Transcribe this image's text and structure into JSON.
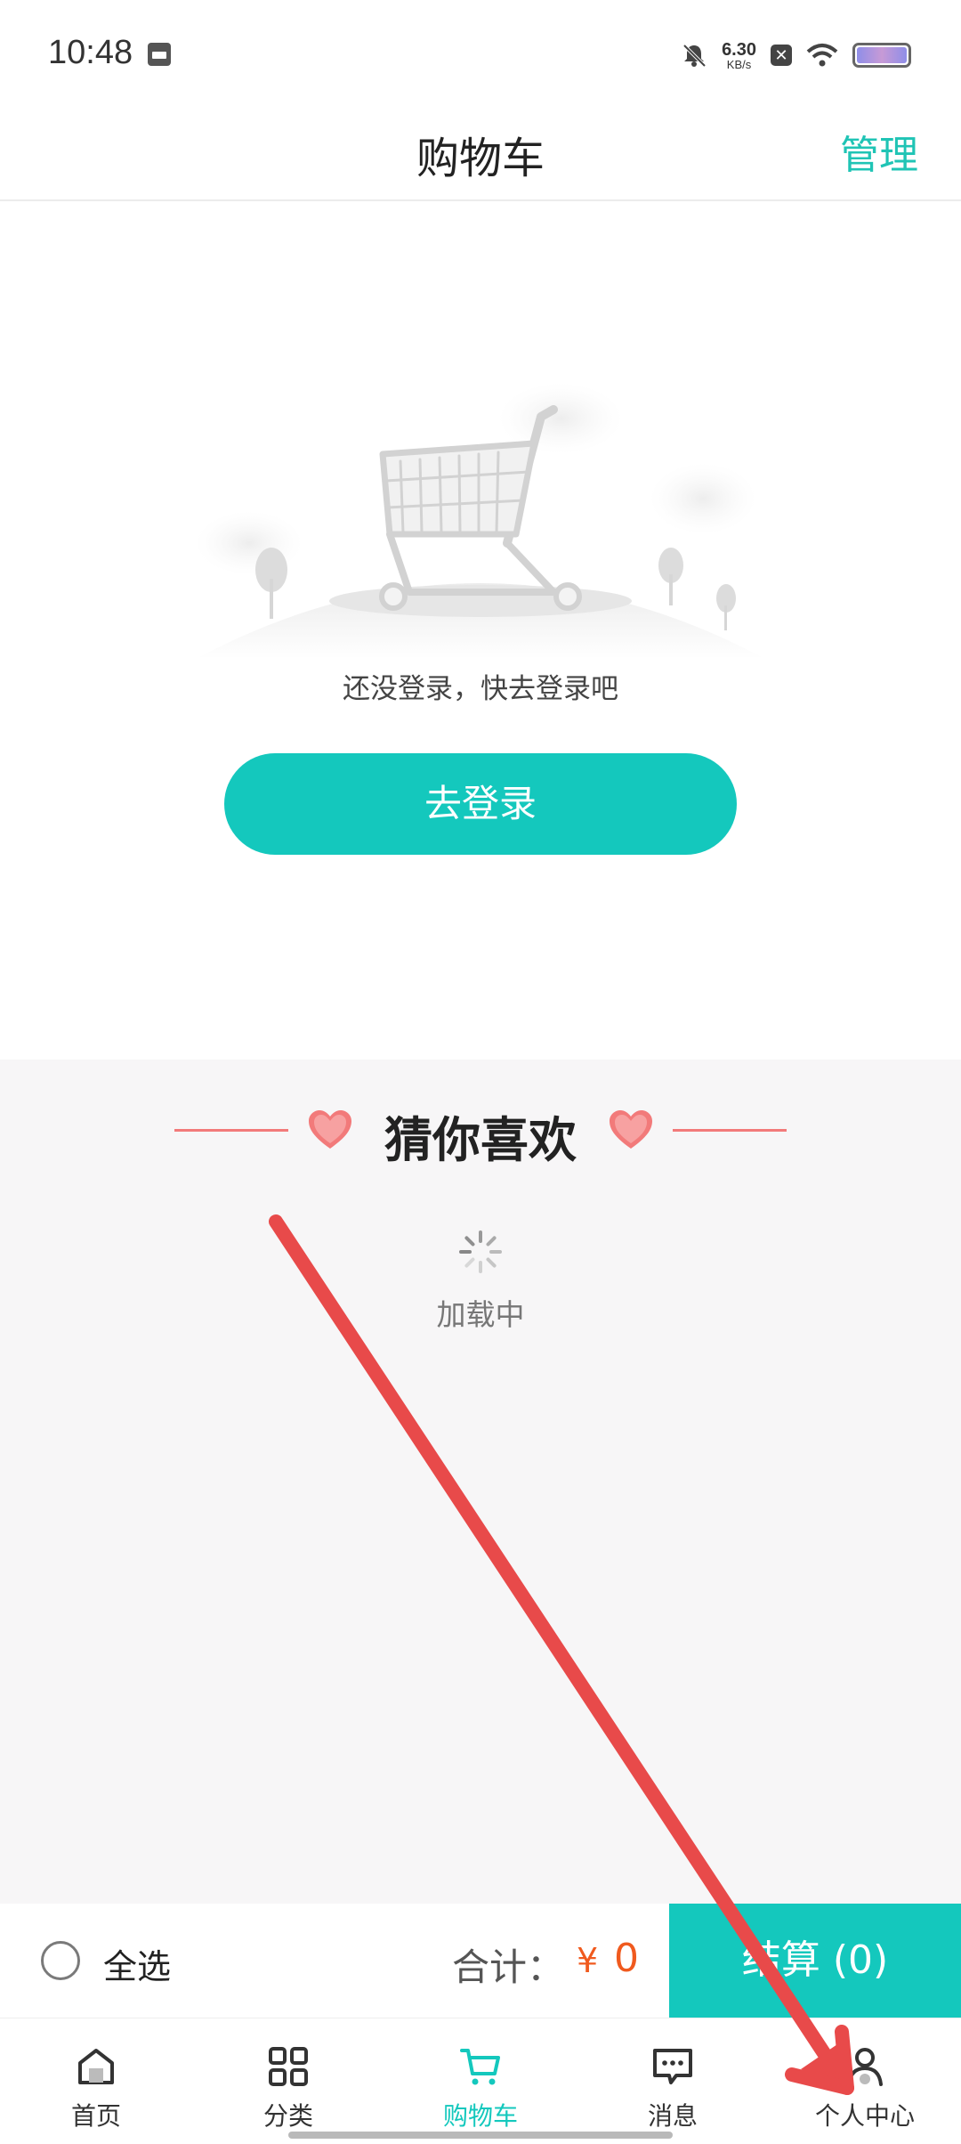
{
  "status_bar": {
    "time": "10:48",
    "net_speed_value": "6.30",
    "net_speed_unit": "KB/s",
    "x_glyph": "✕",
    "icons": [
      "calendar-icon",
      "mute-bell-icon",
      "close-box-icon",
      "wifi-icon",
      "battery-icon"
    ]
  },
  "header": {
    "title": "购物车",
    "manage_label": "管理"
  },
  "empty_state": {
    "message": "还没登录，快去登录吧",
    "login_button": "去登录",
    "illustration_icon": "shopping-cart-illustration"
  },
  "guess_section": {
    "title": "猜你喜欢",
    "loading_text": "加载中"
  },
  "checkout_bar": {
    "select_all_label": "全选",
    "total_label": "合计：",
    "currency": "¥",
    "total_value": "0",
    "checkout_button": "结算 (0)"
  },
  "tabbar": {
    "items": [
      {
        "label": "首页",
        "icon": "home-icon",
        "active": false
      },
      {
        "label": "分类",
        "icon": "category-icon",
        "active": false
      },
      {
        "label": "购物车",
        "icon": "cart-icon",
        "active": true
      },
      {
        "label": "消息",
        "icon": "message-icon",
        "active": false
      },
      {
        "label": "个人中心",
        "icon": "person-icon",
        "active": false
      }
    ]
  },
  "colors": {
    "accent": "#14c8bd",
    "price": "#f05a1e",
    "heart": "#f27a7a",
    "annotation_arrow": "#e84a4a"
  }
}
